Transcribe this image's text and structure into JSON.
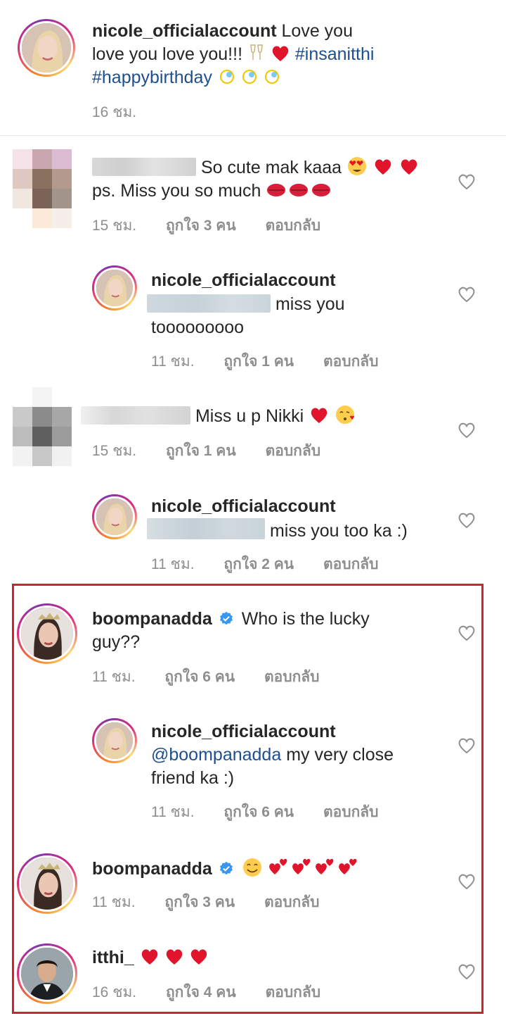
{
  "caption": {
    "username": "nicole_officialaccount",
    "text_1": "Love you",
    "text_2": "love you love you!!!",
    "hashtag_1": "#insanitthi",
    "hashtag_2": "#happybirthday",
    "time": "16 ชม."
  },
  "labels": {
    "reply": "ตอบกลับ"
  },
  "comments": [
    {
      "text_1": "So cute  mak kaaa",
      "text_2": "ps. Miss you so much",
      "time": "15 ชม.",
      "likes": "ถูกใจ 3 คน"
    },
    {
      "username": "nicole_officialaccount",
      "text_1": "miss you",
      "text_2": "tooooooooo",
      "time": "11 ชม.",
      "likes": "ถูกใจ 1 คน"
    },
    {
      "text_1": "Miss u p Nikki",
      "time": "15 ชม.",
      "likes": "ถูกใจ 1 คน"
    },
    {
      "username": "nicole_officialaccount",
      "text_1": "miss you too ka :)",
      "time": "11 ชม.",
      "likes": "ถูกใจ 2 คน"
    },
    {
      "username": "boompanadda",
      "text_1": "Who is the lucky",
      "text_2": "guy??",
      "time": "11 ชม.",
      "likes": "ถูกใจ 6 คน"
    },
    {
      "username": "nicole_officialaccount",
      "mention": "@boompanadda",
      "text_1": "my very close",
      "text_2": "friend ka :)",
      "time": "11 ชม.",
      "likes": "ถูกใจ 6 คน"
    },
    {
      "username": "boompanadda",
      "time": "11 ชม.",
      "likes": "ถูกใจ 3 คน"
    },
    {
      "username": "itthi_",
      "time": "16 ชม.",
      "likes": "ถูกใจ 4 คน"
    }
  ],
  "colors": {
    "highlight_border": "#d51f2b",
    "hashtag": "#1f4f8c",
    "verified": "#3897f0",
    "muted": "#8e8e8e"
  }
}
